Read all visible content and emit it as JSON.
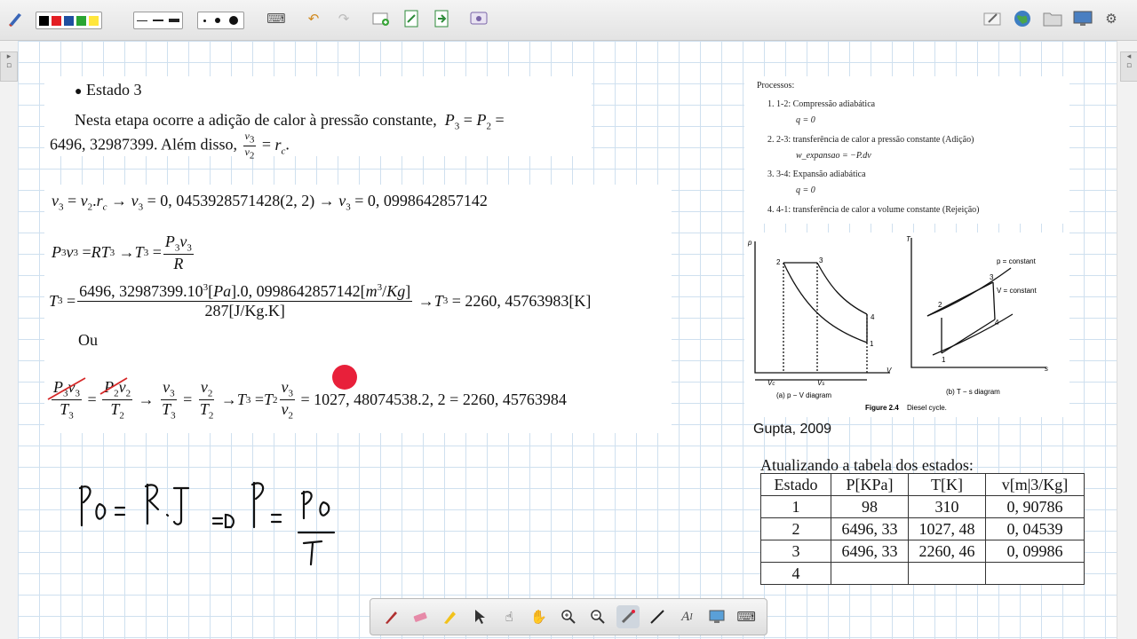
{
  "toolbar": {
    "colors": [
      "#000000",
      "#e31e24",
      "#1e4fa0",
      "#2aa532",
      "#ffe63b"
    ],
    "icons": [
      "pen-settings-icon",
      "keyboard-icon",
      "undo-icon",
      "redo-icon",
      "new-page-icon",
      "page-export-icon",
      "page-import-icon",
      "screen-capture-icon",
      "sticky-note-icon",
      "globe-icon",
      "folder-icon",
      "display-icon",
      "settings-icon"
    ]
  },
  "slide": {
    "bullet": "Estado 3",
    "para_l1": "Nesta etapa ocorre a adição de calor à pressão constante,",
    "para_eq1": "P",
    "para_l2a": "6496, 32987399.  Além disso,",
    "eq1_left": "v",
    "eq1_text": "→ v",
    "eq1_val1": "= 0, 0453928571428(2, 2) → v",
    "eq1_val2": "= 0, 0998642857142",
    "eq2_mid": "= RT",
    "eq2_arrow": "→ T",
    "eq3_num": "6496, 32987399.10",
    "eq3_num_b": "[Pa].0, 0998642857142[m",
    "eq3_num_c": "/Kg]",
    "eq3_den": "287[J/Kg.K]",
    "eq3_res": "→ T",
    "eq3_res_val": "= 2260, 45763983[K]",
    "ou": "Ou",
    "eq4_tail": "= 1027, 48074538.2, 2 = 2260, 45763984",
    "hand_eq": "Pϑ = R.T  ⇒ P = Pϑ / T"
  },
  "processes": {
    "title": "Processos:",
    "items": [
      {
        "label": "1.  1-2: Compressão adiabática",
        "sub": "q = 0"
      },
      {
        "label": "2.  2-3: transferência de calor a pressão constante (Adição)",
        "sub": "w_expansao = −P.dv"
      },
      {
        "label": "3.  3-4: Expansão adiabática",
        "sub": "q = 0"
      },
      {
        "label": "4.  4-1: transferência de calor a volume constante (Rejeição)",
        "sub": ""
      }
    ]
  },
  "figure": {
    "pv_caption": "(a) p − V diagram",
    "ts_caption": "(b) T − s diagram",
    "fig_label": "Figure 2.4",
    "fig_title": "Diesel cycle.",
    "p_const": "p = constant",
    "v_const": "V = constant",
    "source": "Gupta, 2009"
  },
  "states_table": {
    "title": "Atualizando a tabela dos estados:",
    "headers": [
      "Estado",
      "P[KPa]",
      "T[K]",
      "v[m|3/Kg]"
    ],
    "rows": [
      [
        "1",
        "98",
        "310",
        "0, 90786"
      ],
      [
        "2",
        "6496, 33",
        "1027, 48",
        "0, 04539"
      ],
      [
        "3",
        "6496, 33",
        "2260, 46",
        "0, 09986"
      ],
      [
        "4",
        "",
        "",
        ""
      ]
    ]
  },
  "bottom_tools": [
    "pen-icon",
    "eraser-icon",
    "highlighter-icon",
    "select-arrow-icon",
    "pointer-hand-icon",
    "pan-hand-icon",
    "zoom-in-icon",
    "zoom-out-icon",
    "laser-pointer-icon",
    "line-icon",
    "text-icon",
    "screen-icon",
    "keyboard-icon"
  ]
}
